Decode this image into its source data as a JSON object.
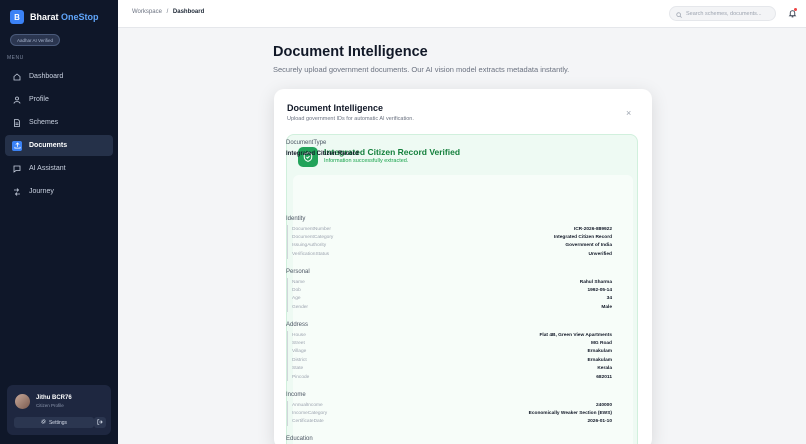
{
  "sidebar": {
    "brand_initial": "B",
    "brand_name": "Bharat",
    "brand_accent": "OneStop",
    "verified_badge": "Aadhar AI Verified",
    "menu_label": "MENU",
    "items": [
      {
        "label": "Dashboard",
        "icon": "home-icon"
      },
      {
        "label": "Profile",
        "icon": "user-icon"
      },
      {
        "label": "Schemes",
        "icon": "document-icon"
      },
      {
        "label": "Documents",
        "icon": "upload-icon",
        "active": true
      },
      {
        "label": "AI Assistant",
        "icon": "chat-icon"
      },
      {
        "label": "Journey",
        "icon": "route-icon"
      }
    ],
    "profile": {
      "name": "Jithu BCR76",
      "role": "Citizen Profile",
      "settings_label": "Settings"
    }
  },
  "topbar": {
    "breadcrumb_root": "Workspace",
    "breadcrumb_sep": "/",
    "breadcrumb_current": "Dashboard",
    "search_placeholder": "Search schemes, documents..."
  },
  "main": {
    "title": "Document Intelligence",
    "subtitle": "Securely upload government documents. Our AI vision model extracts metadata instantly."
  },
  "modal": {
    "title": "Document Intelligence",
    "subtitle": "Upload government IDs for automatic AI verification.",
    "close": "×",
    "status_title": "Integrated Citizen Record Verified",
    "status_sub": "Information successfully extracted.",
    "doc_type_label": "DocumentType",
    "doc_type_value": "Integrated Citizen Record",
    "sections": [
      {
        "title": "Identity",
        "fields": [
          {
            "k": "DocumentNumber",
            "v": "ICR-2026-889922"
          },
          {
            "k": "DocumentCategory",
            "v": "Integrated Citizen Record"
          },
          {
            "k": "IssuingAuthority",
            "v": "Government of India"
          },
          {
            "k": "VerificationStatus",
            "v": "Unverified"
          }
        ]
      },
      {
        "title": "Personal",
        "fields": [
          {
            "k": "Name",
            "v": "Rahul Sharma"
          },
          {
            "k": "Dob",
            "v": "1992-05-14"
          },
          {
            "k": "Age",
            "v": "34"
          },
          {
            "k": "Gender",
            "v": "Male"
          }
        ]
      },
      {
        "title": "Address",
        "fields": [
          {
            "k": "House",
            "v": "Flat 4B, Green View Apartments"
          },
          {
            "k": "Street",
            "v": "MG Road"
          },
          {
            "k": "Village",
            "v": "Ernakulam"
          },
          {
            "k": "District",
            "v": "Ernakulam"
          },
          {
            "k": "State",
            "v": "Kerala"
          },
          {
            "k": "Pincode",
            "v": "682011"
          }
        ]
      },
      {
        "title": "Income",
        "fields": [
          {
            "k": "AnnualIncome",
            "v": "240000"
          },
          {
            "k": "IncomeCategory",
            "v": "Economically Weaker Section (EWS)"
          },
          {
            "k": "CertificateDate",
            "v": "2026-01-10"
          }
        ]
      },
      {
        "title": "Education",
        "fields": []
      }
    ]
  },
  "colors": {
    "sidebar_bg": "#0f1729",
    "accent": "#3b82f6",
    "success": "#15803d"
  }
}
